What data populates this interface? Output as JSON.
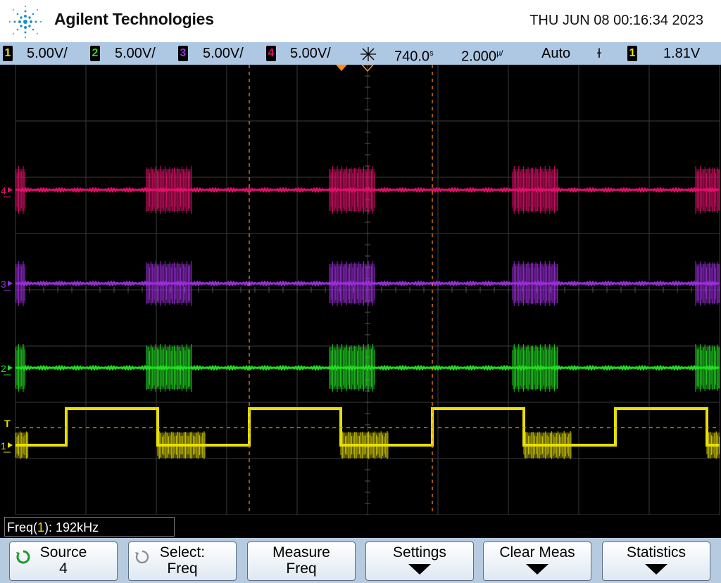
{
  "header": {
    "brand": "Agilent Technologies",
    "datetime": "THU JUN 08 00:16:34 2023"
  },
  "status_bar": {
    "channels": [
      {
        "num": "1",
        "scale": "5.00V/",
        "color": "#e8e000"
      },
      {
        "num": "2",
        "scale": "5.00V/",
        "color": "#22dd22"
      },
      {
        "num": "3",
        "scale": "5.00V/",
        "color": "#9a2ed8"
      },
      {
        "num": "4",
        "scale": "5.00V/",
        "color": "#e0106a"
      }
    ],
    "delay": "740.0",
    "delay_unit": "ns",
    "timebase": "2.000",
    "timebase_unit": "us/",
    "trigger_mode": "Auto",
    "trigger_slope": "ɫ",
    "trigger_channel": "1",
    "trigger_level": "1.81V"
  },
  "screen": {
    "channel_labels": [
      "4",
      "3",
      "2",
      "1"
    ],
    "trigger_marker": "T"
  },
  "measurement": {
    "name": "Freq(",
    "channel": "1",
    "close": "): ",
    "value": "192kHz"
  },
  "softkeys": [
    {
      "line1": "Source",
      "line2": "4",
      "knob": true
    },
    {
      "line1": "Select:",
      "line2": "Freq",
      "knob": true
    },
    {
      "line1": "Measure",
      "line2": "Freq",
      "knob": false
    },
    {
      "line1": "Settings",
      "line2": "",
      "arrow": true
    },
    {
      "line1": "Clear Meas",
      "line2": "",
      "arrow": true
    },
    {
      "line1": "Statistics",
      "line2": "",
      "arrow": true
    }
  ],
  "colors": {
    "ch1": "#e8e000",
    "ch2": "#22dd22",
    "ch3": "#9a2ed8",
    "ch4": "#e0106a",
    "cursor": "#ff8c1a",
    "grid": "#3a3a3a"
  }
}
